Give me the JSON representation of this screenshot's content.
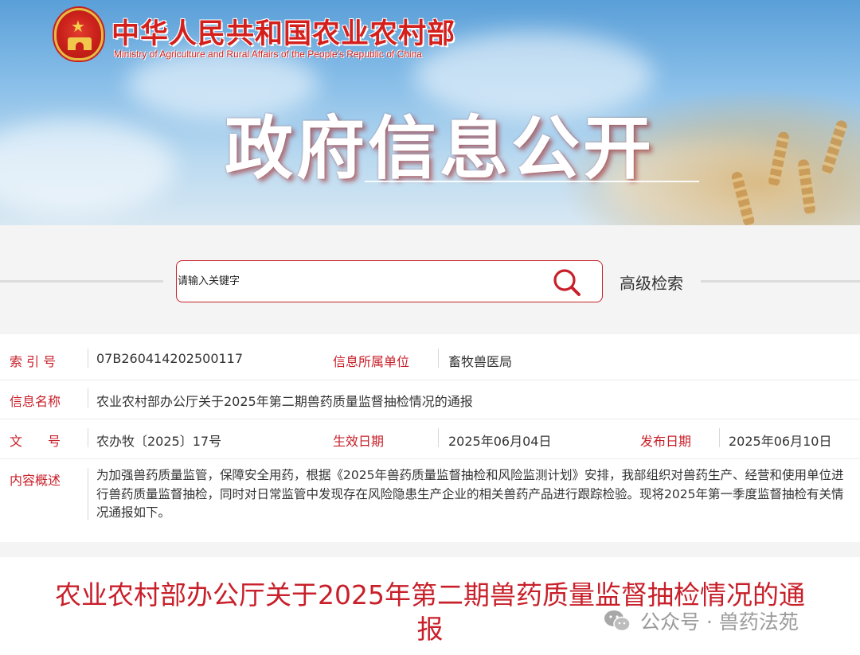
{
  "header": {
    "ministry_cn": "中华人民共和国农业农村部",
    "ministry_en": "Ministry of Agriculture and Rural Affairs of the People's Republic of China",
    "banner_title": "政府信息公开"
  },
  "search": {
    "placeholder": "请输入关键字",
    "advanced_label": "高级检索"
  },
  "info": {
    "index_label": "索 引 号",
    "index_value": "07B260414202500117",
    "unit_label": "信息所属单位",
    "unit_value": "畜牧兽医局",
    "name_label": "信息名称",
    "name_value": "农业农村部办公厅关于2025年第二期兽药质量监督抽检情况的通报",
    "doc_label": "文　　号",
    "doc_value": "农办牧〔2025〕17号",
    "effective_label": "生效日期",
    "effective_value": "2025年06月04日",
    "publish_label": "发布日期",
    "publish_value": "2025年06月10日",
    "summary_label": "内容概述",
    "summary_value": "为加强兽药质量监管，保障安全用药，根据《2025年兽药质量监督抽检和风险监测计划》安排，我部组织对兽药生产、经营和使用单位进行兽药质量监督抽检，同时对日常监管中发现存在风险隐患生产企业的相关兽药产品进行跟踪检验。现将2025年第一季度监督抽检有关情况通报如下。"
  },
  "article": {
    "title": "农业农村部办公厅关于2025年第二期兽药质量监督抽检情况的通报"
  },
  "watermark": {
    "text": "公众号 · 兽药法苑",
    "icon": "wechat-icon"
  },
  "colors": {
    "accent_red": "#c8202a",
    "banner_sky": "#86bde8"
  }
}
